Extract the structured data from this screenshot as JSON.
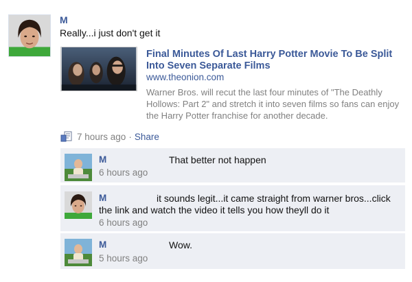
{
  "post": {
    "author": "M",
    "text": "Really...i just don't get it",
    "link": {
      "title": "Final Minutes Of Last Harry Potter Movie To Be Split Into Seven Separate Films",
      "domain": "www.theonion.com",
      "description": "Warner Bros. will recut the last four minutes of \"The Deathly Hollows: Part 2\" and stretch it into seven films so fans can enjoy the Harry Potter franchise for another decade."
    },
    "time": "7 hours ago",
    "separator": "·",
    "share_label": "Share"
  },
  "comments": [
    {
      "author": "M",
      "text": "That better not happen",
      "time": "6 hours ago"
    },
    {
      "author": "M",
      "text": "it sounds legit...it came straight from warner bros...click the link and watch the video it tells you how theyll do it",
      "time": "6 hours ago"
    },
    {
      "author": "M",
      "text": "Wow.",
      "time": "5 hours ago"
    }
  ],
  "colors": {
    "link_blue": "#3b5998",
    "comment_bg": "#edeff4",
    "muted_gray": "#808080"
  },
  "icons": {
    "post_type": "link-post-icon"
  }
}
